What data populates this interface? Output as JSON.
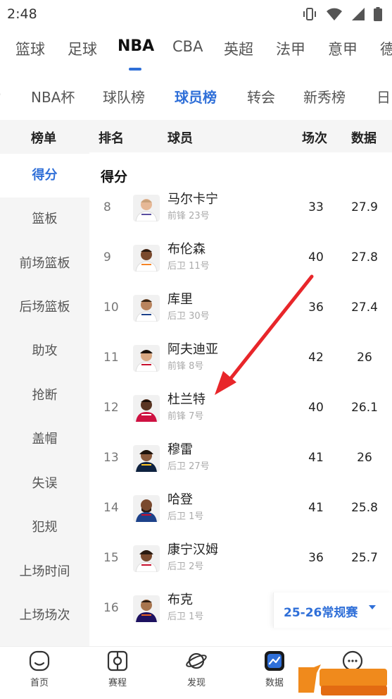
{
  "status_bar": {
    "time": "2:48"
  },
  "top_tabs": [
    "篮球",
    "足球",
    "NBA",
    "CBA",
    "英超",
    "法甲",
    "意甲",
    "德"
  ],
  "sub_tabs": [
    "NBA杯",
    "球队榜",
    "球员榜",
    "转会",
    "新秀榜",
    "日"
  ],
  "table_headers": {
    "board": "榜单",
    "rank": "排名",
    "player": "球员",
    "games": "场次",
    "data": "数据"
  },
  "sidebar": [
    "得分",
    "篮板",
    "前场篮板",
    "后场篮板",
    "助攻",
    "抢断",
    "盖帽",
    "失误",
    "犯规",
    "上场时间",
    "上场场次"
  ],
  "section_title": "得分",
  "players": [
    {
      "rank": "8",
      "name": "马尔卡宁",
      "pos": "前锋 23号",
      "games": "33",
      "pts": "27.9"
    },
    {
      "rank": "9",
      "name": "布伦森",
      "pos": "后卫 11号",
      "games": "40",
      "pts": "27.8"
    },
    {
      "rank": "10",
      "name": "库里",
      "pos": "后卫 30号",
      "games": "36",
      "pts": "27.4"
    },
    {
      "rank": "11",
      "name": "阿夫迪亚",
      "pos": "前锋 8号",
      "games": "42",
      "pts": "26"
    },
    {
      "rank": "12",
      "name": "杜兰特",
      "pos": "前锋 7号",
      "games": "40",
      "pts": "26.1"
    },
    {
      "rank": "13",
      "name": "穆雷",
      "pos": "后卫 27号",
      "games": "41",
      "pts": "26"
    },
    {
      "rank": "14",
      "name": "哈登",
      "pos": "后卫 1号",
      "games": "41",
      "pts": "25.8"
    },
    {
      "rank": "15",
      "name": "康宁汉姆",
      "pos": "后卫 2号",
      "games": "36",
      "pts": "25.7"
    },
    {
      "rank": "16",
      "name": "布克",
      "pos": "后卫 1号",
      "games": "",
      "pts": ""
    }
  ],
  "season_selector": "25-26常规赛",
  "bottom_nav": [
    "首页",
    "赛程",
    "发现",
    "数据"
  ],
  "colors": {
    "accent": "#2f6fd8",
    "sidebar_bg": "#f5f5f5",
    "arrow": "#e8262a",
    "watermark": "#f08a1c"
  },
  "icons": [
    "vibrate-icon",
    "wifi-icon",
    "signal-icon",
    "battery-icon",
    "home-icon",
    "schedule-icon",
    "discover-icon",
    "data-icon",
    "chat-icon"
  ]
}
